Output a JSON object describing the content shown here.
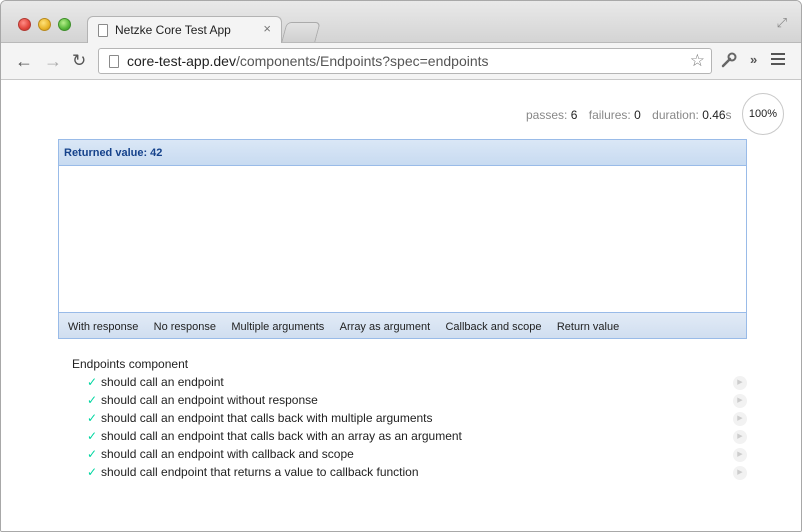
{
  "browser": {
    "tab_title": "Netzke Core Test App",
    "tab_close": "×",
    "url_host": "core-test-app.dev",
    "url_path": "/components/Endpoints?spec=endpoints",
    "icons": {
      "back": "←",
      "forward": "→",
      "reload": "↻",
      "star": "☆",
      "wrench": "🔧",
      "overflow": "»",
      "fullscreen": "⤢"
    }
  },
  "stats": {
    "passes_label": "passes:",
    "passes_value": "6",
    "failures_label": "failures:",
    "failures_value": "0",
    "duration_label": "duration:",
    "duration_value": "0.46",
    "duration_unit": "s",
    "progress": "100%"
  },
  "panel": {
    "title": "Returned value: 42",
    "buttons": [
      "With response",
      "No response",
      "Multiple arguments",
      "Array as argument",
      "Callback and scope",
      "Return value"
    ]
  },
  "suite": {
    "title": "Endpoints component",
    "check": "✓",
    "replay": "▶",
    "tests": [
      "should call an endpoint",
      "should call an endpoint without response",
      "should call an endpoint that calls back with multiple arguments",
      "should call an endpoint that calls back with an array as an argument",
      "should call an endpoint with callback and scope",
      "should call endpoint that returns a value to callback function"
    ]
  },
  "colors": {
    "panel_border": "#99bbe8",
    "panel_title": "#15428b",
    "check": "#00d6a1"
  }
}
